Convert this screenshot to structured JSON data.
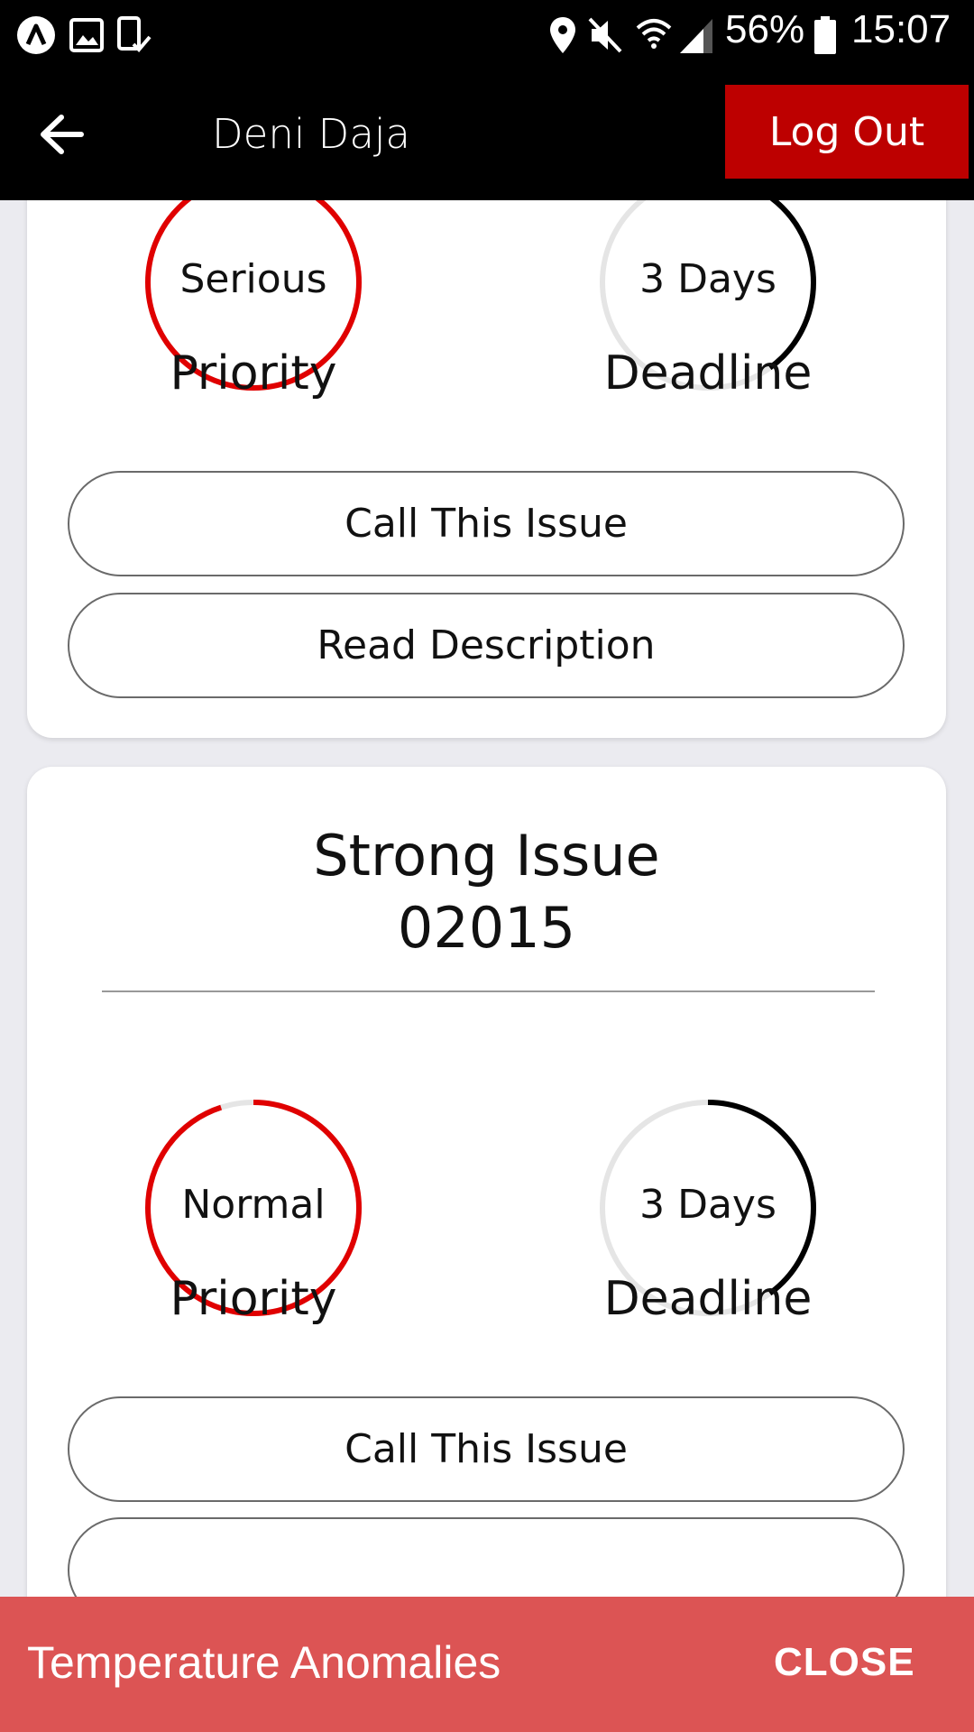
{
  "status_bar": {
    "battery": "56%",
    "time": "15:07",
    "icons": [
      "app-logo-icon",
      "gallery-icon",
      "download-done-icon",
      "location-icon",
      "mute-icon",
      "wifi-icon",
      "signal-icon",
      "battery-icon"
    ]
  },
  "header": {
    "user_name": "Deni Daja",
    "logout_label": "Log Out"
  },
  "cards": [
    {
      "priority_value": "Serious",
      "priority_fill": 1.0,
      "priority_label": "Priority",
      "deadline_value": "3 Days",
      "deadline_fill": 0.4,
      "deadline_label": "Deadline",
      "call_label": "Call This Issue",
      "read_label": "Read Description"
    },
    {
      "title": "Strong Issue",
      "number": "02015",
      "priority_value": "Normal",
      "priority_fill": 0.95,
      "priority_label": "Priority",
      "deadline_value": "3 Days",
      "deadline_fill": 0.4,
      "deadline_label": "Deadline",
      "call_label": "Call This Issue"
    }
  ],
  "colors": {
    "accent_red": "#e00000",
    "logout_bg": "#bd0000",
    "snackbar_bg": "#dc5454"
  },
  "snackbar": {
    "message": "Temperature Anomalies",
    "action": "CLOSE"
  }
}
